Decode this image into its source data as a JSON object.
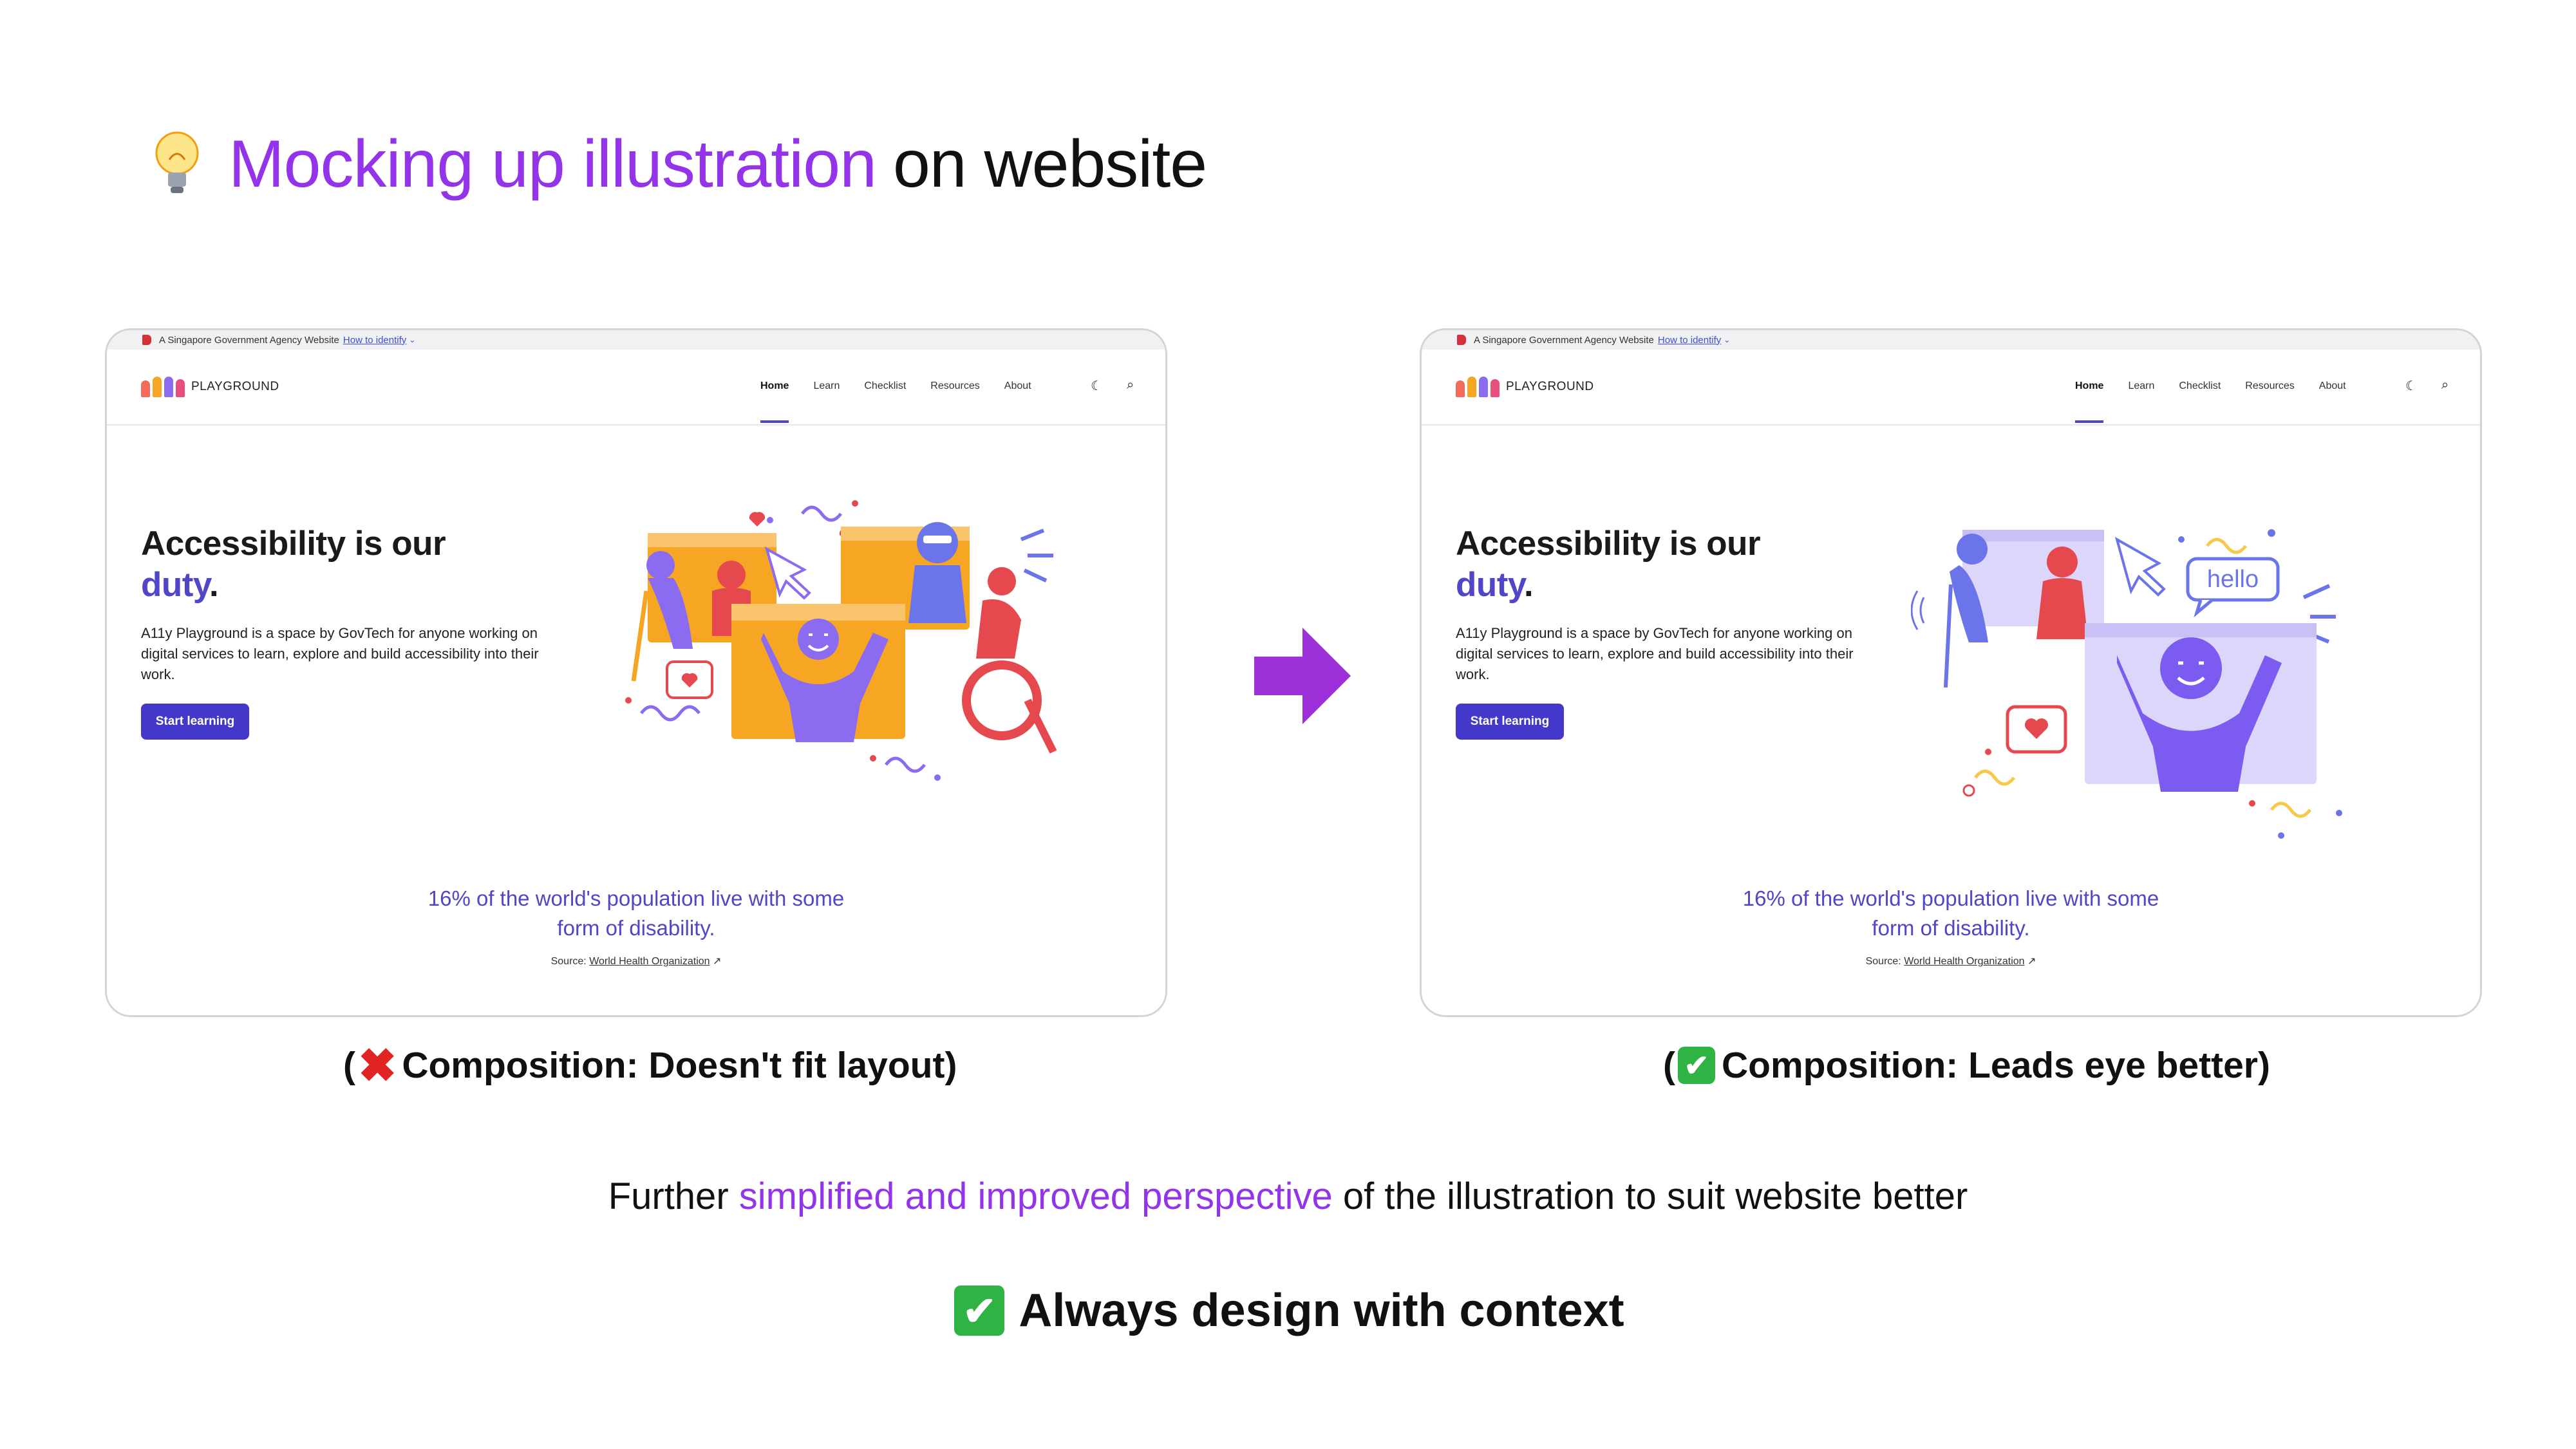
{
  "slide": {
    "title_highlight": "Mocking up illustration",
    "title_rest": "on website",
    "title_icon": "lightbulb-icon",
    "summary_prefix": "Further",
    "summary_highlight": "simplified and improved perspective",
    "summary_suffix": "of the illustration to suit website better",
    "takeaway": "Always design with context",
    "colors": {
      "accent_purple": "#9333ea",
      "brand_indigo": "#4f46c8",
      "arrow": "#9b30d9",
      "good": "#2fb344",
      "bad": "#e02424"
    }
  },
  "left_mockup": {
    "gov_bar": {
      "text": "A Singapore Government Agency Website",
      "link": "How to identify"
    },
    "logo_text": "PLAYGROUND",
    "nav": [
      "Home",
      "Learn",
      "Checklist",
      "Resources",
      "About"
    ],
    "hero_title_line1": "Accessibility is our",
    "hero_title_accent": "duty",
    "hero_title_period": ".",
    "hero_desc": "A11y Playground is a space by GovTech for anyone working on digital services to learn, explore and build accessibility into their work.",
    "cta": "Start learning",
    "stat": "16% of the world's population live with some form of disability.",
    "source_label": "Source:",
    "source_link": "World Health Organization",
    "caption": "Composition: Doesn't fit layout)",
    "caption_open": "("
  },
  "right_mockup": {
    "gov_bar": {
      "text": "A Singapore Government Agency Website",
      "link": "How to identify"
    },
    "logo_text": "PLAYGROUND",
    "nav": [
      "Home",
      "Learn",
      "Checklist",
      "Resources",
      "About"
    ],
    "hero_title_line1": "Accessibility is our",
    "hero_title_accent": "duty",
    "hero_title_period": ".",
    "hero_desc": "A11y Playground is a space by GovTech for anyone working on digital services to learn, explore and build accessibility into their work.",
    "cta": "Start learning",
    "stat": "16% of the world's population live with some form of disability.",
    "source_label": "Source:",
    "source_link": "World Health Organization",
    "illustration_bubble": "hello",
    "caption": "Composition: Leads eye better)",
    "caption_open": "("
  }
}
